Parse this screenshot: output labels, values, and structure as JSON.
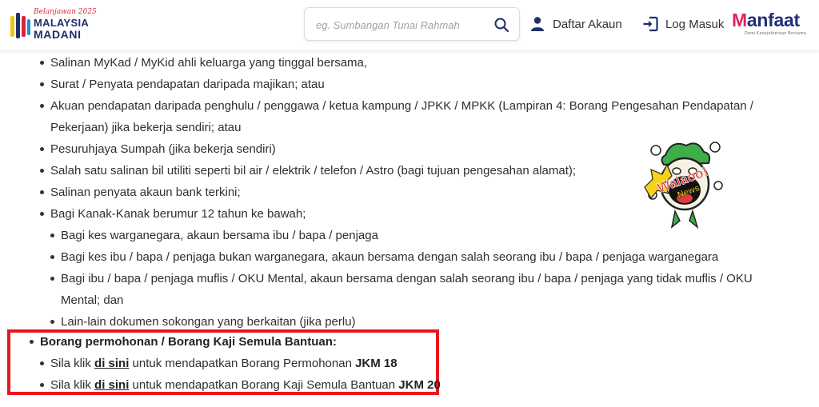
{
  "header": {
    "logo": {
      "tagline": "Belanjawan 2025",
      "line1": "MALAYSIA",
      "line2": "MADANI"
    },
    "search": {
      "placeholder": "eg. Sumbangan Tunai Rahmah",
      "value": ""
    },
    "nav": {
      "register_label": "Daftar Akaun",
      "login_label": "Log Masuk"
    },
    "brand": {
      "name": "Manfaat",
      "tagline": "Demi Kesejahteraan Bersama"
    }
  },
  "content": {
    "items": [
      "Salinan MyKad / MyKid ahli keluarga yang tinggal bersama,",
      "Surat / Penyata pendapatan daripada majikan; atau",
      "Akuan pendapatan daripada penghulu / penggawa / ketua kampung / JPKK / MPKK (Lampiran 4: Borang Pengesahan Pendapatan /",
      "Pekerjaan) jika bekerja sendiri; atau",
      "Pesuruhjaya Sumpah (jika bekerja sendiri)",
      "Salah satu salinan bil utiliti seperti bil air / elektrik / telefon / Astro (bagi tujuan pengesahan alamat);",
      "Salinan penyata akaun bank terkini;",
      "Bagi Kanak-Kanak berumur 12 tahun ke bawah;"
    ],
    "sub_items": [
      "Bagi kes warganegara, akaun bersama ibu / bapa / penjaga",
      "Bagi kes ibu / bapa / penjaga bukan warganegara, akaun bersama dengan salah seorang ibu / bapa / penjaga warganegara",
      "Bagi ibu / bapa / penjaga muflis / OKU Mental, akaun bersama dengan salah seorang ibu / bapa / penjaga yang tidak muflis / OKU",
      "Mental; dan",
      "Lain-lain dokumen sokongan yang berkaitan (jika perlu)"
    ],
    "forms": {
      "heading": "Borang permohonan / Borang Kaji Semula Bantuan:",
      "link1_prefix": "Sila klik",
      "link1_text": "di sini",
      "link1_suffix": "untuk mendapatkan Borang Permohonan",
      "link1_code": "JKM 18",
      "link2_prefix": "Sila klik",
      "link2_text": "di sini",
      "link2_suffix": "untuk mendapatkan Borang Kaji Semula Bantuan",
      "link2_code": "JKM 20"
    },
    "watermark": {
      "line1": "Walaoo!",
      "line2": "News"
    }
  },
  "colors": {
    "brand_navy": "#1f2f6b",
    "brand_pink": "#e0245e",
    "highlight_red": "#e8171c",
    "mascot_green": "#3fae49",
    "mascot_yellow": "#f7d21b"
  }
}
